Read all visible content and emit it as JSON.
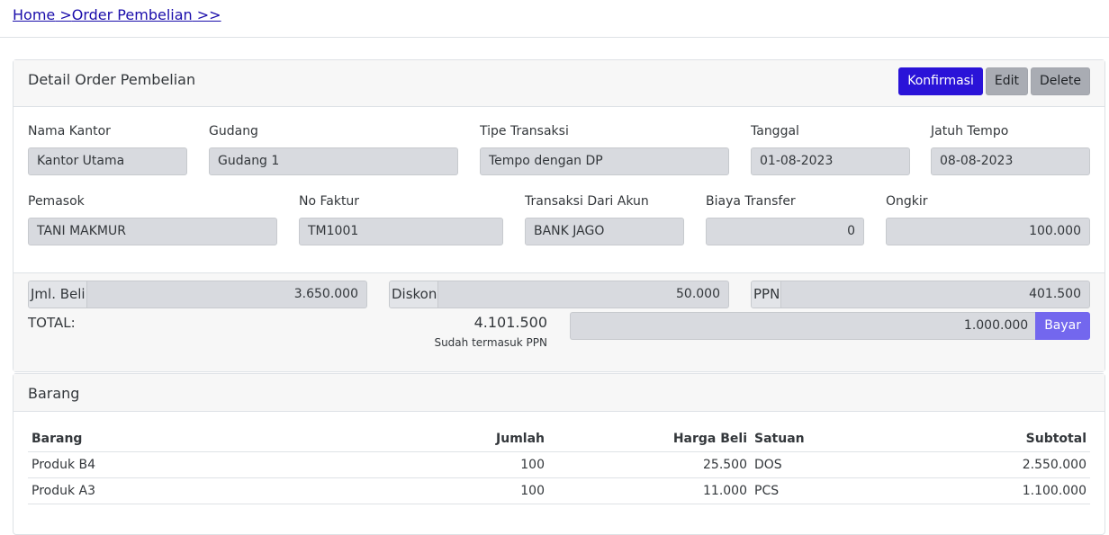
{
  "breadcrumb": {
    "home": "Home",
    "sep1": " >",
    "current": "Order Pembelian",
    "sep2": " >>"
  },
  "detail": {
    "title": "Detail Order Pembelian",
    "actions": {
      "confirm": "Konfirmasi",
      "edit": "Edit",
      "delete": "Delete"
    },
    "fields": {
      "nama_kantor": {
        "label": "Nama Kantor",
        "value": "Kantor Utama"
      },
      "gudang": {
        "label": "Gudang",
        "value": "Gudang 1"
      },
      "tipe_transaksi": {
        "label": "Tipe Transaksi",
        "value": "Tempo dengan DP"
      },
      "tanggal": {
        "label": "Tanggal",
        "value": "01-08-2023"
      },
      "jatuh_tempo": {
        "label": "Jatuh Tempo",
        "value": "08-08-2023"
      },
      "pemasok": {
        "label": "Pemasok",
        "value": "TANI MAKMUR"
      },
      "no_faktur": {
        "label": "No Faktur",
        "value": "TM1001"
      },
      "transaksi_akun": {
        "label": "Transaksi Dari Akun",
        "value": "BANK JAGO"
      },
      "biaya_transfer": {
        "label": "Biaya Transfer",
        "value": "0"
      },
      "ongkir": {
        "label": "Ongkir",
        "value": "100.000"
      }
    },
    "summary": {
      "jml_beli": {
        "label": "Jml. Beli",
        "value": "3.650.000"
      },
      "diskon": {
        "label": "Diskon",
        "value": "50.000"
      },
      "ppn": {
        "label": "PPN",
        "value": "401.500"
      },
      "total_label": "TOTAL:",
      "total_value": "4.101.500",
      "total_note": "Sudah termasuk PPN",
      "bayar_value": "1.000.000",
      "bayar_label": "Bayar"
    }
  },
  "barang": {
    "title": "Barang",
    "columns": {
      "barang": "Barang",
      "jumlah": "Jumlah",
      "harga": "Harga Beli",
      "satuan": "Satuan",
      "subtotal": "Subtotal"
    },
    "rows": [
      {
        "barang": "Produk B4",
        "jumlah": "100",
        "harga": "25.500",
        "satuan": "DOS",
        "subtotal": "2.550.000"
      },
      {
        "barang": "Produk A3",
        "jumlah": "100",
        "harga": "11.000",
        "satuan": "PCS",
        "subtotal": "1.100.000"
      }
    ]
  }
}
